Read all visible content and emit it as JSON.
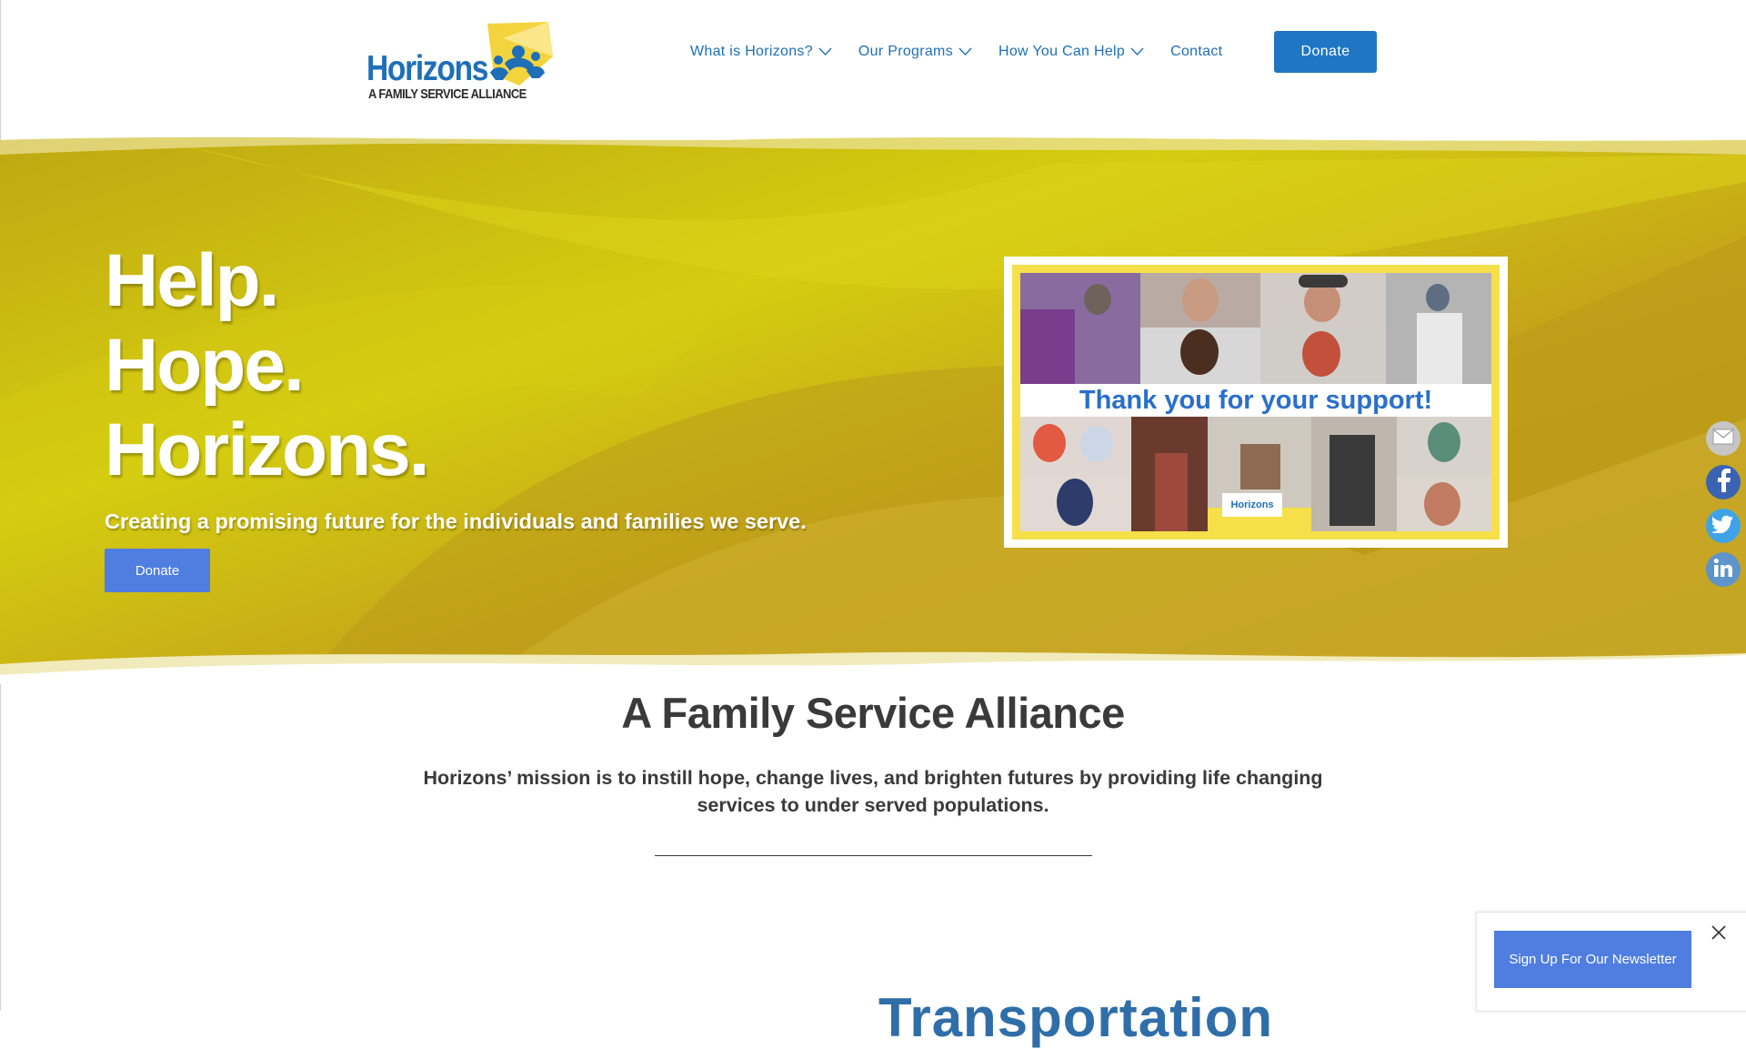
{
  "header": {
    "logo_word": "Horizons",
    "logo_tagline": "A FAMILY SERVICE ALLIANCE",
    "nav": [
      {
        "label": "What is Horizons?",
        "has_dropdown": true
      },
      {
        "label": "Our Programs",
        "has_dropdown": true
      },
      {
        "label": "How You Can Help",
        "has_dropdown": true
      },
      {
        "label": "Contact",
        "has_dropdown": false
      }
    ],
    "donate_label": "Donate"
  },
  "hero": {
    "lines": [
      "Help.",
      "Hope.",
      "Horizons."
    ],
    "subtitle": "Creating a promising future for the individuals and families we serve.",
    "donate_label": "Donate",
    "image_caption": "Thank you for your support!",
    "image_logo_text": "Horizons"
  },
  "social": [
    {
      "icon": "email-icon"
    },
    {
      "icon": "facebook-icon"
    },
    {
      "icon": "twitter-icon"
    },
    {
      "icon": "linkedin-icon"
    }
  ],
  "mission": {
    "title": "A Family Service Alliance",
    "text": "Horizons’ mission is to instill hope, change lives, and brighten futures by providing life changing services to under served populations.",
    "next_heading": "Transportation"
  },
  "newsletter": {
    "button_label": "Sign Up For Our Newsletter"
  },
  "colors": {
    "brand_blue": "#1e6fb8",
    "button_blue": "#4f7ee0",
    "hero_yellow": "#c9b20d"
  }
}
